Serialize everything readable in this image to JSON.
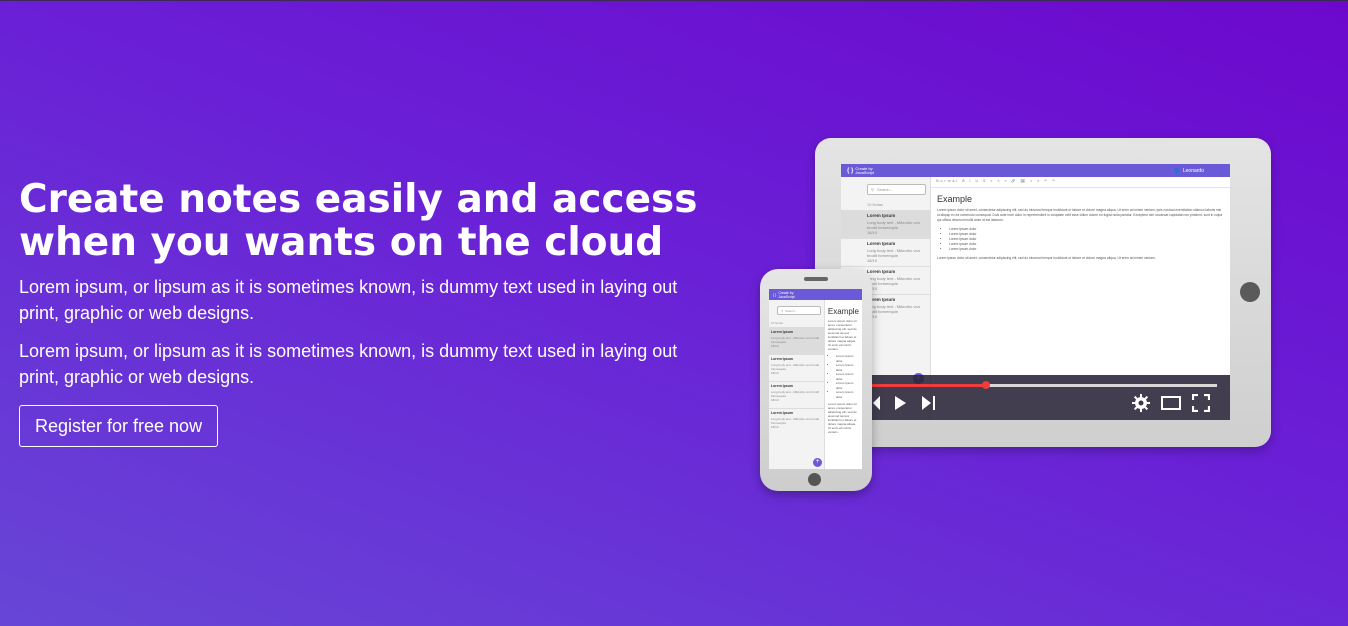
{
  "hero": {
    "title": "Create notes easily and access when you wants on the cloud",
    "paragraphs": [
      "Lorem ipsum, or lipsum as it is sometimes known, is dummy text used in laying out print, graphic or web designs.",
      "Lorem ipsum, or lipsum as it is sometimes known, is dummy text used in laying out print, graphic or web designs."
    ],
    "cta_label": "Register for free now"
  },
  "mockup": {
    "app_logo_line1": "Create by",
    "app_logo_line2": "JavaScript",
    "user_name": "Leonardo",
    "search_placeholder": "Search...",
    "notes_count": "10 Notas",
    "notes": [
      {
        "title": "Lorem Ipsum",
        "body": "Long body text - Mikrorbo von brodit formeequie",
        "date": "18/10"
      },
      {
        "title": "Lorem Ipsum",
        "body": "Long body text - Mikrorbo von brodit formeequie",
        "date": "18/10"
      },
      {
        "title": "Lorem Ipsum",
        "body": "Long body text - Mikrorbo von brodit formeequie",
        "date": "18/10"
      },
      {
        "title": "Lorem Ipsum",
        "body": "Long body text - Mikrorbo von brodit formeequie",
        "date": "18/10"
      }
    ],
    "fab_label": "+",
    "toolbar_text": "Normal  B I U S  ≡ ≡ ≡  🔗 🖼  ≡ ≡  ↶ ↷",
    "doc_title": "Example",
    "doc_paragraph": "Lorem ipsum dolor sit amet, consectetur adipiscing elit, sed do eiusmod tempor incididunt ut labore et dolore magna aliqua. Ut enim ad minim veniam, quis nostrud exercitation ullamco laboris nisi ut aliquip ex ea commodo consequat. Duis aute irure dolor in reprehenderit in voluptate velit esse cillum dolore eu fugiat nulla pariatur. Excepteur sint occaecat cupidatat non proident, sunt in culpa qui officia deserunt mollit anim id est laborum.",
    "doc_list": [
      "Lorem Ipsum dolor",
      "Lorem Ipsum dolor",
      "Lorem Ipsum dolor",
      "Lorem Ipsum dolor",
      "Lorem Ipsum dolor"
    ],
    "doc_paragraph_short": "Lorem ipsum dolor sit amet, consectetur adipiscing elit, sed do eiusmod tempor incididunt ut labore et dolore magna aliqua. Ut enim ad minim veniam.",
    "video_progress_percent": 34
  },
  "colors": {
    "accent": "#6a5ad8",
    "video_progress": "#f03c3c"
  }
}
